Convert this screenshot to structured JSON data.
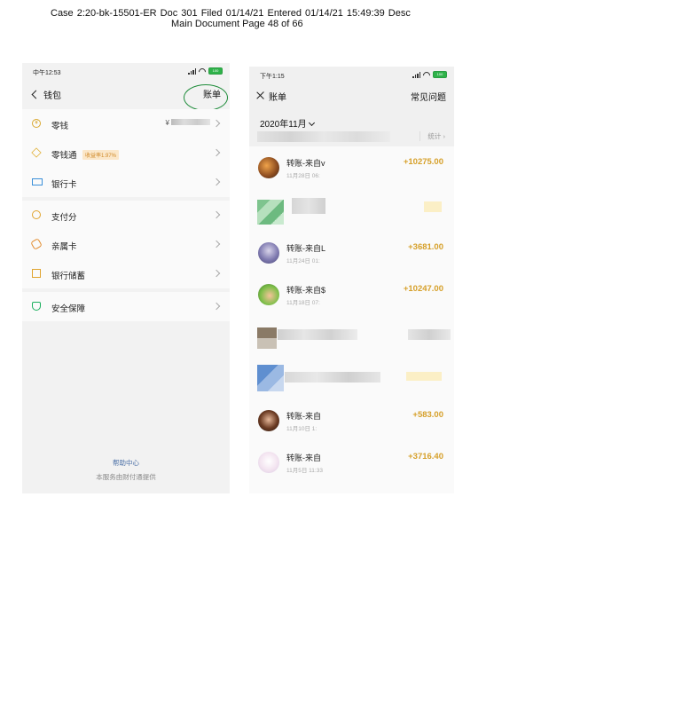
{
  "header": {
    "line1": "Case 2:20-bk-15501-ER     Doc 301     Filed 01/14/21     Entered 01/14/21 15:49:39     Desc",
    "line2": "Main Document       Page 48 of 66"
  },
  "wallet_screen": {
    "time": "中午12:53",
    "battery": "100",
    "title": "钱包",
    "bills_link": "账单",
    "items": [
      {
        "label": "零钱",
        "icon": "yuan-coin-icon",
        "value": "¥"
      },
      {
        "label": "零钱通",
        "icon": "diamond-icon",
        "badge": "收益率1.97%"
      },
      {
        "label": "银行卡",
        "icon": "card-icon"
      },
      {
        "label": "支付分",
        "icon": "score-icon"
      },
      {
        "label": "亲属卡",
        "icon": "family-card-icon"
      },
      {
        "label": "银行储蓄",
        "icon": "bank-icon"
      },
      {
        "label": "安全保障",
        "icon": "shield-icon"
      }
    ],
    "help_center": "帮助中心",
    "provider": "本服务由财付通提供"
  },
  "bill_screen": {
    "time": "下午1:15",
    "battery": "100",
    "title": "账单",
    "faq": "常见问题",
    "month": "2020年11月",
    "stats": "统计",
    "transactions": [
      {
        "name": "转账-来自v",
        "date": "11月28日 06:",
        "amount": "+10275.00"
      },
      {
        "name": "转账-来自L",
        "date": "11月24日 01:",
        "amount": "+3681.00"
      },
      {
        "name": "转账-来自$",
        "date": "11月18日 07:",
        "amount": "+10247.00"
      },
      {
        "name": "转账-来自",
        "date": "11月10日 1:",
        "amount": "+583.00"
      },
      {
        "name": "转账-来自",
        "date": "11月5日 11:33",
        "amount": "+3716.40"
      }
    ]
  },
  "colors": {
    "amount": "#d6a02a",
    "accent_green": "#1aaf5d",
    "annotation_circle": "#1e8c3a"
  }
}
